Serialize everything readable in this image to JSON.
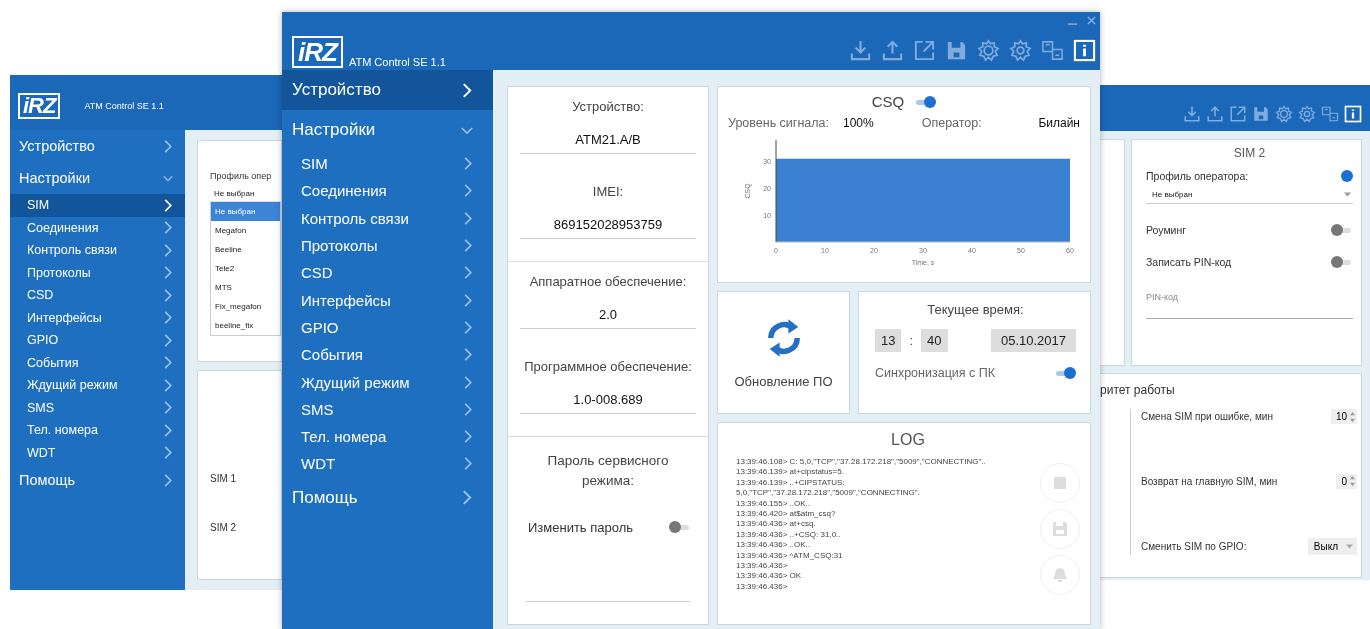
{
  "left_window": {
    "logo": "iRZ",
    "title": "ATM Control SE 1.1",
    "nav": [
      {
        "label": "Устройство",
        "selected": false
      },
      {
        "label": "Настройки",
        "selected": false,
        "expanded": true,
        "children": [
          {
            "label": "SIM",
            "selected": true
          },
          {
            "label": "Соединения",
            "selected": false
          },
          {
            "label": "Контроль связи",
            "selected": false
          },
          {
            "label": "Протоколы",
            "selected": false
          },
          {
            "label": "CSD",
            "selected": false
          },
          {
            "label": "Интерфейсы",
            "selected": false
          },
          {
            "label": "GPIO",
            "selected": false
          },
          {
            "label": "События",
            "selected": false
          },
          {
            "label": "Ждущий режим",
            "selected": false
          },
          {
            "label": "SMS",
            "selected": false
          },
          {
            "label": "Тел. номера",
            "selected": false
          },
          {
            "label": "WDT",
            "selected": false
          }
        ]
      },
      {
        "label": "Помощь",
        "selected": false
      }
    ],
    "profile_label": "Профиль опер",
    "profile_value": "Не выбран",
    "profile_options": [
      {
        "label": "Не выбран",
        "selected": true
      },
      {
        "label": "Megafon",
        "selected": false
      },
      {
        "label": "Beeline",
        "selected": false
      },
      {
        "label": "Tele2",
        "selected": false
      },
      {
        "label": "MTS",
        "selected": false
      },
      {
        "label": "Fix_megafon",
        "selected": false
      },
      {
        "label": "beeline_fix",
        "selected": false
      }
    ],
    "sim_rows": [
      "SIM 1",
      "SIM 2"
    ]
  },
  "middle_window": {
    "logo": "iRZ",
    "title": "ATM Control SE 1.1",
    "nav": [
      {
        "label": "Устройство",
        "selected": true
      },
      {
        "label": "Настройки",
        "selected": false,
        "expanded": true,
        "children": [
          {
            "label": "SIM",
            "selected": false
          },
          {
            "label": "Соединения",
            "selected": false
          },
          {
            "label": "Контроль связи",
            "selected": false
          },
          {
            "label": "Протоколы",
            "selected": false
          },
          {
            "label": "CSD",
            "selected": false
          },
          {
            "label": "Интерфейсы",
            "selected": false
          },
          {
            "label": "GPIO",
            "selected": false
          },
          {
            "label": "События",
            "selected": false
          },
          {
            "label": "Ждущий режим",
            "selected": false
          },
          {
            "label": "SMS",
            "selected": false
          },
          {
            "label": "Тел. номера",
            "selected": false
          },
          {
            "label": "WDT",
            "selected": false
          }
        ]
      },
      {
        "label": "Помощь",
        "selected": false
      }
    ],
    "info": [
      {
        "label": "Устройство:",
        "value": "ATM21.A/B"
      },
      {
        "label": "IMEI:",
        "value": "869152028953759"
      }
    ],
    "versions": [
      {
        "label": "Аппаратное обеспечение:",
        "value": "2.0"
      },
      {
        "label": "Программное обеспечение:",
        "value": "1.0-008.689"
      }
    ],
    "password": {
      "title": "Пароль сервисного режима:",
      "change_label": "Изменить пароль",
      "change_on": false
    },
    "csq": {
      "title": "CSQ",
      "on": true,
      "signal_label": "Уровень сигнала:",
      "signal_value": "100%",
      "operator_label": "Оператор:",
      "operator_value": "Билайн",
      "chart_data": {
        "type": "area",
        "xlabel": "Time, s",
        "ylabel": "CSQ",
        "x": [
          0,
          60
        ],
        "series": [
          {
            "color": "#3b7fd0",
            "values": [
              31,
              31
            ]
          }
        ],
        "xlim": [
          0,
          60
        ],
        "ylim": [
          0,
          38
        ],
        "xticks": [
          0,
          10,
          20,
          30,
          40,
          50,
          60
        ],
        "yticks": [
          10,
          20,
          30
        ]
      }
    },
    "update": {
      "label": "Обновление ПО"
    },
    "time": {
      "title": "Текущее время:",
      "hours": "13",
      "separator": ":",
      "minutes": "40",
      "date": "05.10.2017",
      "sync_label": "Синхронизация с ПК",
      "sync_on": true
    },
    "log": {
      "title": "LOG",
      "lines": [
        "13:39:46.108> C: 5,0,\"TCP\",\"37.28.172.218\",\"5009\",\"CONNECTING\"..",
        "13:39:46.139> at+cipstatus=5.",
        "13:39:46.139> ..+CIPSTATUS:",
        "5,0,\"TCP\",\"37.28.172.218\",\"5009\",\"CONNECTING\".",
        "13:39:46.155> ..OK..",
        "13:39:46.420> at$atm_csq?",
        "13:39:46.436> at+csq.",
        "13:39:46.436> ..+CSQ: 31,0..",
        "13:39:46.436> ..OK..",
        "13:39:46.436> ^ATM_CSQ:31",
        "13:39:46.436>",
        "13:39:46.436> OK",
        "13:39:46.436>"
      ]
    }
  },
  "right_window": {
    "sim2": {
      "title": "SIM 2",
      "profile_label": "Профиль оператора:",
      "profile_value": "Не выбран",
      "toggles": [
        {
          "label": "Роуминг",
          "on": false
        },
        {
          "label": "Записать PIN-код",
          "on": false
        }
      ],
      "pin_placeholder": "PIN-код"
    },
    "priority": {
      "title": "ритет работы",
      "rows": [
        {
          "kind": "spinner",
          "label": "Смена SIM при ошибке, мин",
          "value": "10"
        },
        {
          "kind": "spinner",
          "label": "Возврат на главную SIM, мин",
          "value": "0"
        },
        {
          "kind": "select",
          "label": "Сменить SIM по GPIO:",
          "value": "Выкл"
        }
      ]
    }
  }
}
